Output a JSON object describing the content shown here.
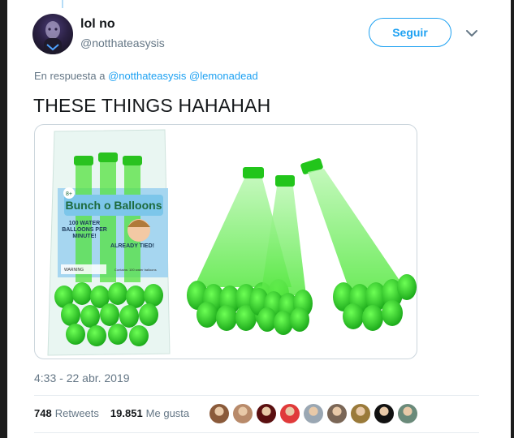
{
  "user": {
    "name": "lol no",
    "handle": "@notthateasysis"
  },
  "follow_label": "Seguir",
  "reply": {
    "prefix": "En respuesta a",
    "mentions": [
      "@notthateasysis",
      "@lemonadead"
    ]
  },
  "tweet_text": "THESE THINGS HAHAHAH",
  "media": {
    "package_brand": "Bunch o Balloons",
    "package_badge": "8+",
    "package_left_text": "100 WATER BALLOONS PER MINUTE!",
    "package_right_text": "ALREADY TIED!",
    "package_warning": "WARNING",
    "package_fine_print": "Contains: 100 water balloons",
    "colors": {
      "balloon": "#3de62a",
      "balloon_dark": "#1aa81a",
      "package_blue": "#9fd3ef"
    }
  },
  "timestamp": "4:33 - 22 abr. 2019",
  "stats": {
    "retweets_count": "748",
    "retweets_label": "Retweets",
    "likes_count": "19.851",
    "likes_label": "Me gusta"
  },
  "likers": [
    {
      "name": "liker-1",
      "color": "#8a5a3a"
    },
    {
      "name": "liker-2",
      "color": "#b88a6a"
    },
    {
      "name": "liker-3",
      "color": "#5a0f10"
    },
    {
      "name": "liker-4",
      "color": "#e03a3a"
    },
    {
      "name": "liker-5",
      "color": "#9aa7b3"
    },
    {
      "name": "liker-6",
      "color": "#7a6656"
    },
    {
      "name": "liker-7",
      "color": "#9a7a3a"
    },
    {
      "name": "liker-8",
      "color": "#111111"
    },
    {
      "name": "liker-9",
      "color": "#6a8a7a"
    }
  ],
  "icons": {
    "caret": "chevron-down-icon"
  }
}
